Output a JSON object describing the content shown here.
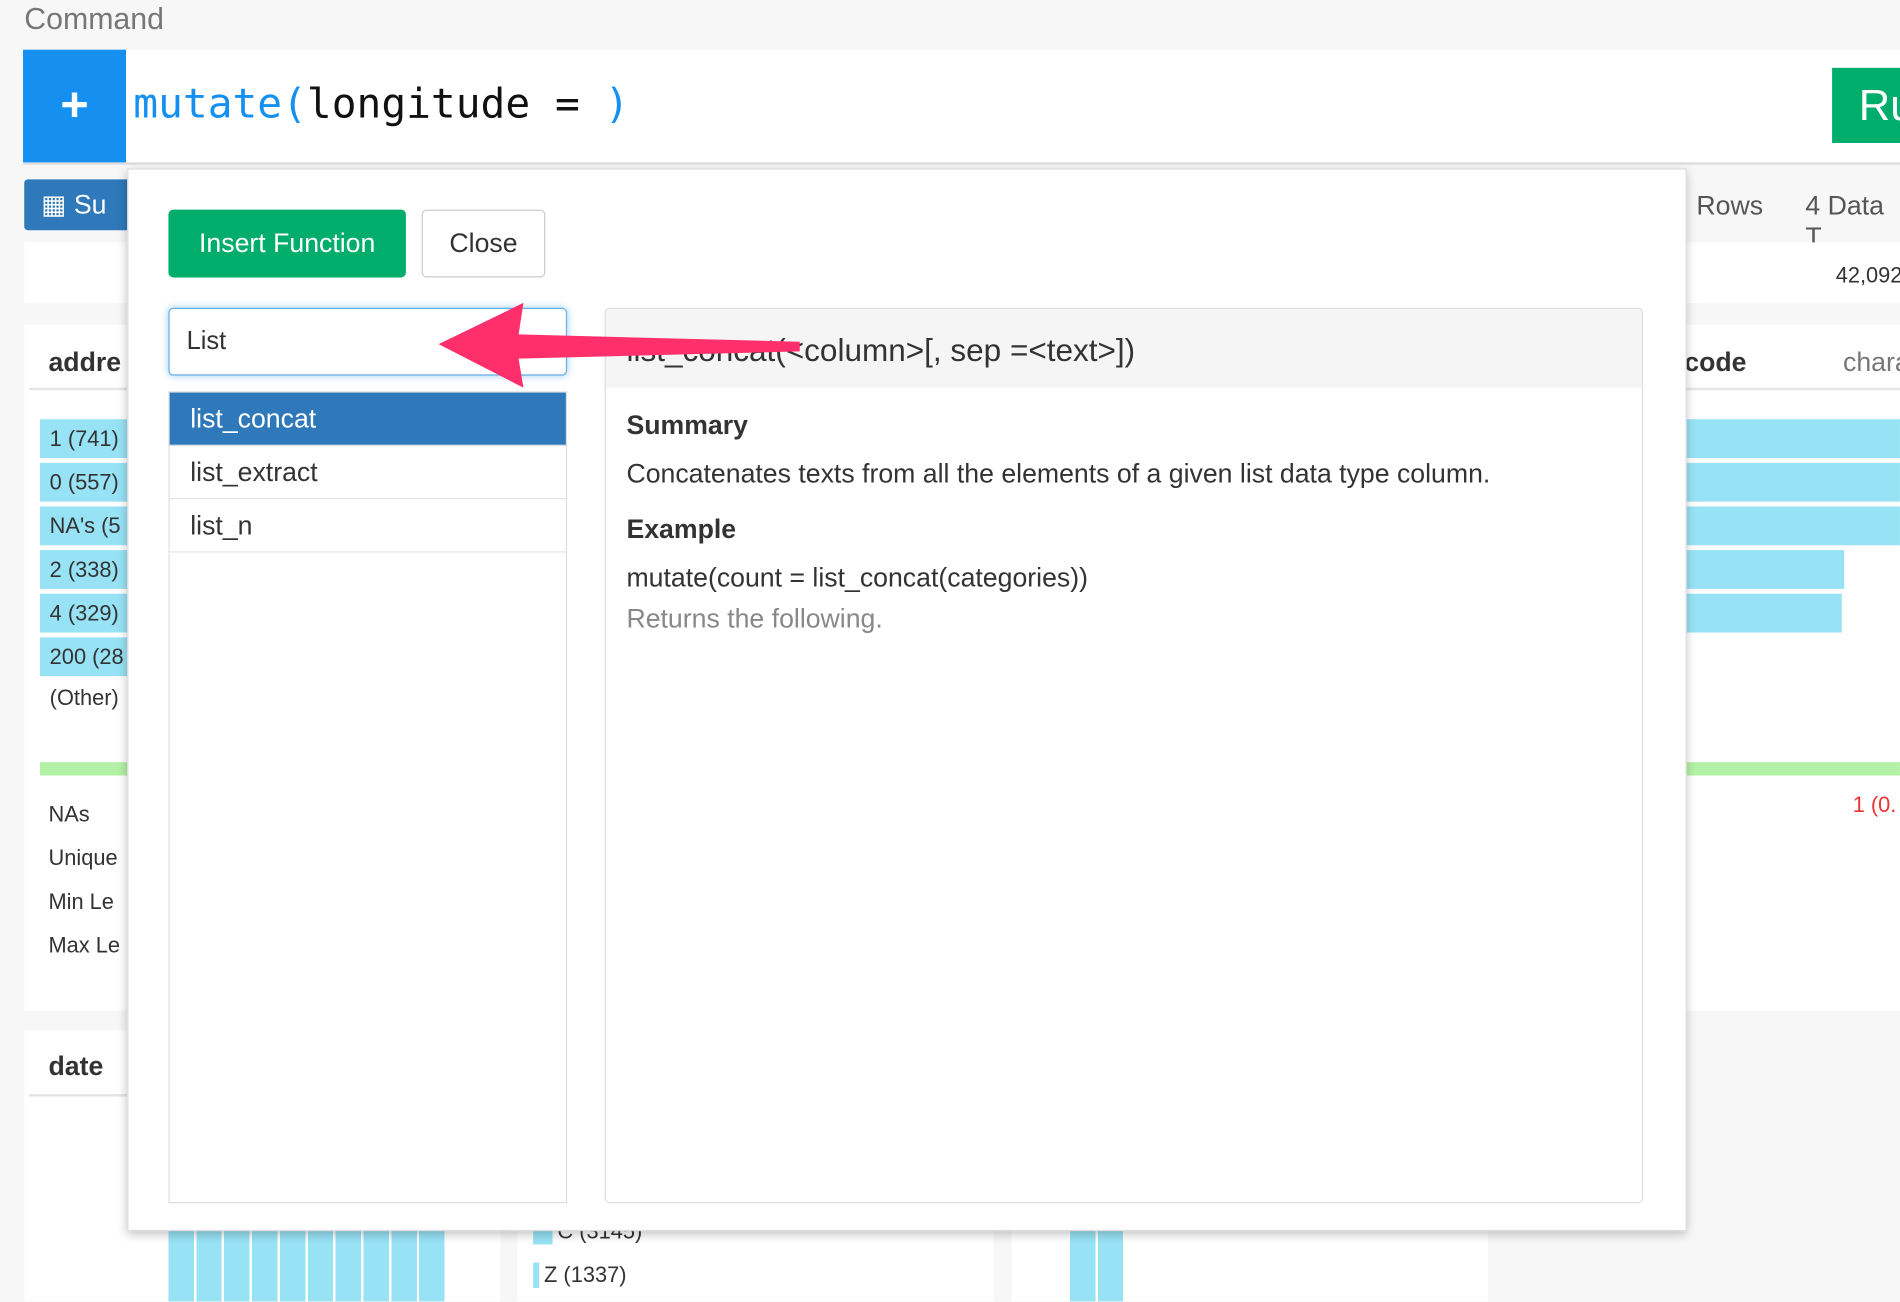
{
  "command": {
    "label": "Command",
    "function": "mutate(",
    "args": "longitude = ",
    "close_paren": ")",
    "run_label": "Ru"
  },
  "toolbar": {
    "summary_label": "Su",
    "rows_label": "Rows",
    "data_type_label": "4 Data T",
    "count": "42,092"
  },
  "background": {
    "column1": {
      "title": "addre",
      "bars": [
        "1 (741)",
        "0 (557)",
        "NA's (5",
        "2 (338)",
        "4 (329)",
        "200 (28"
      ],
      "other": "(Other)",
      "stats": [
        "NAs",
        "Unique",
        "Min Le",
        "Max Le"
      ]
    },
    "column2": {
      "title": "code",
      "type": "chara",
      "na_value": "1 (0."
    },
    "column3": {
      "title": "date"
    },
    "bottom_bars": [
      "C (3145)",
      "Z (1337)"
    ]
  },
  "modal": {
    "insert_label": "Insert Function",
    "close_label": "Close",
    "search_value": "List",
    "functions": [
      "list_concat",
      "list_extract",
      "list_n"
    ],
    "selected_index": 0,
    "signature": "list_concat(<column>[, sep =<text>])",
    "summary_heading": "Summary",
    "summary_text": "Concatenates texts from all the elements of a given list data type column.",
    "example_heading": "Example",
    "example_code": "mutate(count = list_concat(categories))",
    "example_note": "Returns the following."
  },
  "colors": {
    "accent": "#1590f0",
    "run": "#00ad6a",
    "selected": "#2f78ba",
    "arrow": "#ff2f6c",
    "bar": "#97e2f5"
  }
}
